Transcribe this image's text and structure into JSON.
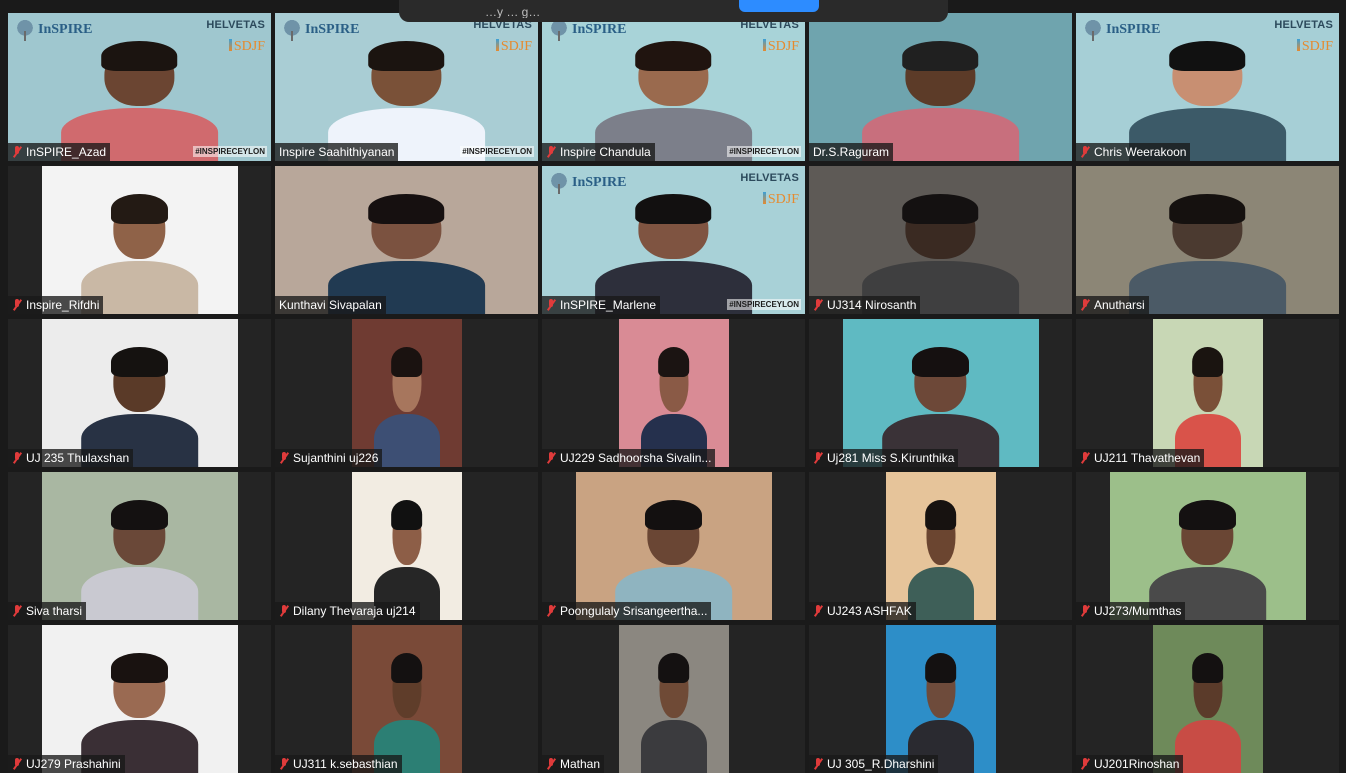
{
  "meeting": {
    "topbar_title": "…y … g…"
  },
  "colors": {
    "active_speaker_outline": "#e6e65a",
    "name_label_bg": "#181818",
    "mute_icon": "#e03b3b",
    "topbar_button": "#2d8cff"
  },
  "participants": [
    {
      "name": "InSPIRE_Azad",
      "muted": true,
      "logos": true,
      "hashtag": "#INSPIRECEYLON",
      "bg": "#9fc7cf",
      "skin": "#6b4532",
      "shirt": "#d06a6e",
      "hair": "#1b1410",
      "fit": "full"
    },
    {
      "name": "Inspire Saahithiyanan",
      "muted": false,
      "active": true,
      "logos": true,
      "hashtag": "#INSPIRECEYLON",
      "bg": "#a9cdd4",
      "skin": "#7a5138",
      "shirt": "#eef3fb",
      "hair": "#1b1410",
      "fit": "full"
    },
    {
      "name": "Inspire Chandula",
      "muted": true,
      "logos": true,
      "hashtag": "#INSPIRECEYLON",
      "bg": "#a8d3d8",
      "skin": "#9a6a4e",
      "shirt": "#7c7f8a",
      "hair": "#20140f",
      "fit": "full"
    },
    {
      "name": "Dr.S.Raguram",
      "muted": false,
      "logos": false,
      "bg": "#6fa4ae",
      "skin": "#5c3b28",
      "shirt": "#c86f7d",
      "hair": "#202020",
      "fit": "full"
    },
    {
      "name": "Chris Weerakoon",
      "muted": true,
      "logos": true,
      "bg": "#a6cfd6",
      "skin": "#c88f72",
      "shirt": "#3c5a68",
      "hair": "#111111",
      "fit": "full"
    },
    {
      "name": "Inspire_Rifdhi",
      "muted": true,
      "logos": false,
      "bg": "#f3f3f3",
      "skin": "#8f6248",
      "shirt": "#c9b8a5",
      "hair": "#231a14",
      "fit": "narrow",
      "vw": 196
    },
    {
      "name": "Kunthavi Sivapalan",
      "muted": false,
      "logos": false,
      "bg": "#b8a79a",
      "skin": "#7b5240",
      "shirt": "#213a52",
      "hair": "#161010",
      "fit": "full"
    },
    {
      "name": "InSPIRE_Marlene",
      "muted": true,
      "logos": true,
      "hashtag": "#INSPIRECEYLON",
      "bg": "#a8d1d7",
      "skin": "#7f5441",
      "shirt": "#2d2f3b",
      "hair": "#121010",
      "fit": "full"
    },
    {
      "name": "UJ314 Nirosanth",
      "muted": true,
      "logos": false,
      "bg": "#5e5a56",
      "skin": "#3a2a22",
      "shirt": "#3f3f40",
      "hair": "#141111",
      "fit": "full"
    },
    {
      "name": "Anutharsi",
      "muted": true,
      "logos": false,
      "bg": "#8c8676",
      "skin": "#4b3a30",
      "shirt": "#4b5a66",
      "hair": "#15110f",
      "fit": "full"
    },
    {
      "name": "UJ 235 Thulaxshan",
      "muted": true,
      "logos": false,
      "bg": "#ececec",
      "skin": "#5a3a28",
      "shirt": "#283244",
      "hair": "#151210",
      "fit": "narrow",
      "vw": 196
    },
    {
      "name": "Sujanthini uj226",
      "muted": true,
      "logos": false,
      "bg": "#6f3b32",
      "skin": "#a7765d",
      "shirt": "#3d4f74",
      "hair": "#1a1210",
      "fit": "narrow",
      "vw": 110
    },
    {
      "name": "UJ229 Sadhoorsha Sivalin...",
      "muted": true,
      "logos": false,
      "bg": "#d98b95",
      "skin": "#8a5a46",
      "shirt": "#25304d",
      "hair": "#1b1412",
      "fit": "narrow",
      "vw": 110
    },
    {
      "name": "Uj281 Miss S.Kirunthika",
      "muted": true,
      "logos": false,
      "bg": "#5fbac2",
      "skin": "#6d4838",
      "shirt": "#3a3237",
      "hair": "#151010",
      "fit": "narrow",
      "vw": 196
    },
    {
      "name": "UJ211 Thavathevan",
      "muted": true,
      "logos": false,
      "bg": "#c8d7b5",
      "skin": "#7a5038",
      "shirt": "#d9534a",
      "hair": "#1a1410",
      "fit": "narrow",
      "vw": 110
    },
    {
      "name": "Siva tharsi",
      "muted": true,
      "logos": false,
      "bg": "#a9b7a2",
      "skin": "#6a4838",
      "shirt": "#c9c9d1",
      "hair": "#141111",
      "fit": "narrow",
      "vw": 196
    },
    {
      "name": "Dilany Thevaraja uj214",
      "muted": true,
      "logos": false,
      "bg": "#f2ece2",
      "skin": "#8d5e47",
      "shirt": "#262626",
      "hair": "#111111",
      "fit": "narrow",
      "vw": 110
    },
    {
      "name": "Poongulaly Srisangeertha...",
      "muted": true,
      "logos": false,
      "bg": "#c9a382",
      "skin": "#6a4634",
      "shirt": "#8fb4c0",
      "hair": "#131010",
      "fit": "narrow",
      "vw": 196
    },
    {
      "name": "UJ243 ASHFAK",
      "muted": true,
      "logos": false,
      "bg": "#e6c49a",
      "skin": "#6b4530",
      "shirt": "#3e5f58",
      "hair": "#171210",
      "fit": "narrow",
      "vw": 110
    },
    {
      "name": "UJ273/Mumthas",
      "muted": true,
      "logos": false,
      "bg": "#9cbf8a",
      "skin": "#6a4634",
      "shirt": "#4a4a4a",
      "hair": "#141111",
      "fit": "narrow",
      "vw": 196
    },
    {
      "name": "UJ279 Prashahini",
      "muted": true,
      "logos": false,
      "bg": "#f1f1f1",
      "skin": "#9a6a52",
      "shirt": "#3a2f35",
      "hair": "#191210",
      "fit": "narrow",
      "vw": 196
    },
    {
      "name": "UJ311 k.sebasthian",
      "muted": true,
      "logos": false,
      "bg": "#7a4a38",
      "skin": "#5f3d2a",
      "shirt": "#2c7f74",
      "hair": "#141111",
      "fit": "narrow",
      "vw": 110
    },
    {
      "name": "Mathan",
      "muted": true,
      "logos": false,
      "bg": "#8b8780",
      "skin": "#6f4a36",
      "shirt": "#3b3b3e",
      "hair": "#141111",
      "fit": "narrow",
      "vw": 110
    },
    {
      "name": "UJ 305_R.Dharshini",
      "muted": true,
      "logos": false,
      "bg": "#2d8ec8",
      "skin": "#6e4b3b",
      "shirt": "#2a2a30",
      "hair": "#141111",
      "fit": "narrow",
      "vw": 110
    },
    {
      "name": "UJ201Rinoshan",
      "muted": true,
      "logos": false,
      "bg": "#6e8a5a",
      "skin": "#5b3b2a",
      "shirt": "#c84c45",
      "hair": "#141111",
      "fit": "narrow",
      "vw": 110
    }
  ],
  "logo": {
    "left_text": "InSPIRE",
    "right_top": "HELVETAS",
    "right_bottom": "SDJF"
  }
}
